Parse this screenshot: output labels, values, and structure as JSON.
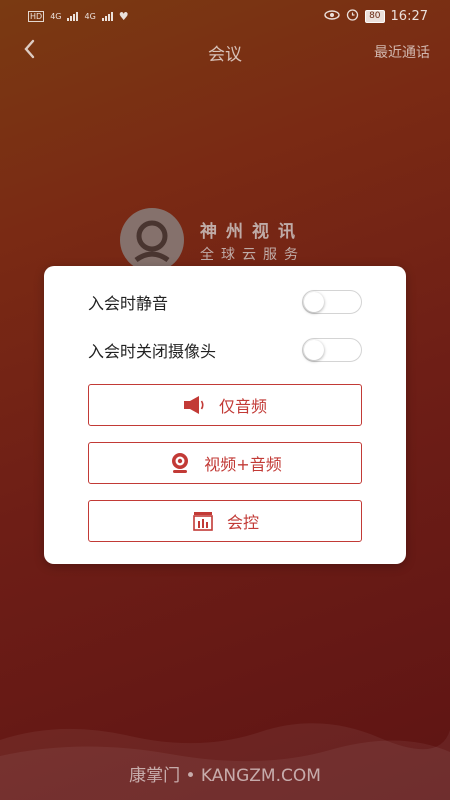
{
  "status_bar": {
    "left_badges": [
      "HD",
      "HD",
      "4G",
      "4G"
    ],
    "battery": "80",
    "time": "16:27"
  },
  "nav": {
    "title": "会议",
    "back_icon": "chevron-left-icon",
    "recent_link": "最近通话"
  },
  "brand": {
    "name": "神州视讯",
    "slogan": "全球云服务"
  },
  "dialog": {
    "options": [
      {
        "label": "入会时静音",
        "enabled": false
      },
      {
        "label": "入会时关闭摄像头",
        "enabled": false
      }
    ],
    "buttons": [
      {
        "label": "仅音频",
        "icon": "speaker-icon"
      },
      {
        "label": "视频+音频",
        "icon": "webcam-icon"
      },
      {
        "label": "会控",
        "icon": "meeting-control-icon"
      }
    ]
  },
  "footer": {
    "watermark": "康掌门 • KANGZM.COM"
  },
  "colors": {
    "accent": "#c23a36",
    "background_top": "#7a3a12",
    "background_bottom": "#5e1414"
  }
}
